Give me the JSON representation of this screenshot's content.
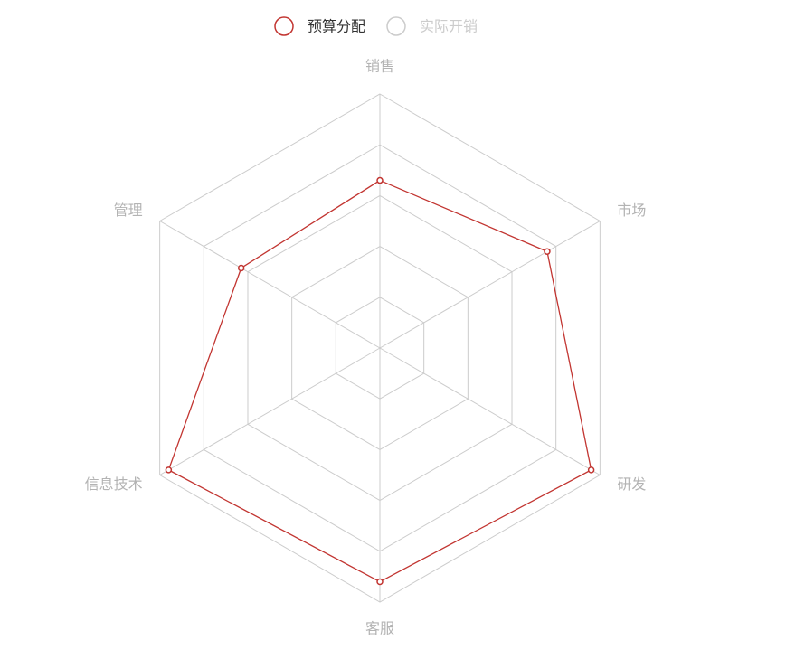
{
  "chart_data": {
    "type": "radar",
    "legend": {
      "position": "top-center",
      "items": [
        {
          "name": "预算分配",
          "color": "#c23531",
          "active": true
        },
        {
          "name": "实际开销",
          "color": "#cccccc",
          "active": false
        }
      ]
    },
    "indicators": [
      {
        "name": "销售",
        "max": 1
      },
      {
        "name": "市场",
        "max": 1
      },
      {
        "name": "研发",
        "max": 1
      },
      {
        "name": "客服",
        "max": 1
      },
      {
        "name": "信息技术",
        "max": 1
      },
      {
        "name": "管理",
        "max": 1
      }
    ],
    "split_number": 5,
    "series": [
      {
        "name": "预算分配",
        "color": "#c23531",
        "values": [
          0.66,
          0.76,
          0.96,
          0.92,
          0.96,
          0.63
        ]
      }
    ],
    "colors": {
      "grid": "#cccccc",
      "label": "#b3b3b3",
      "legend_inactive": "#cccccc",
      "legend_active_text": "#333333"
    }
  }
}
